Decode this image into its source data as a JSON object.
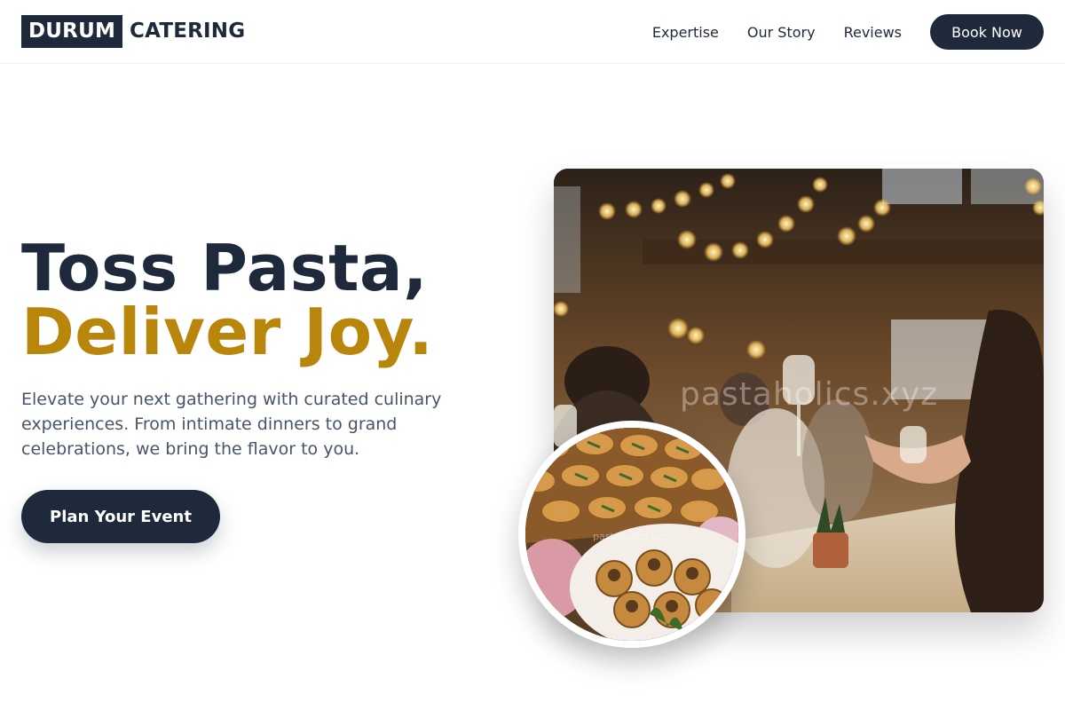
{
  "brand": {
    "logo_box_text": "DURUM",
    "logo_text": "CATERING"
  },
  "nav": {
    "links": [
      "Expertise",
      "Our Story",
      "Reviews"
    ],
    "book_label": "Book Now"
  },
  "hero": {
    "title_line1": "Toss Pasta,",
    "title_line2": "Deliver Joy.",
    "description": "Elevate your next gathering with curated culinary experiences. From intimate dinners to grand celebrations, we bring the flavor to you.",
    "cta_label": "Plan Your Event"
  },
  "images": {
    "main_watermark": "pastaholics.xyz",
    "food_watermark": "pastaholics.xyz"
  },
  "colors": {
    "primary": "#1e293b",
    "accent": "#b8860b",
    "text_muted": "#475569",
    "background": "#ffffff"
  }
}
